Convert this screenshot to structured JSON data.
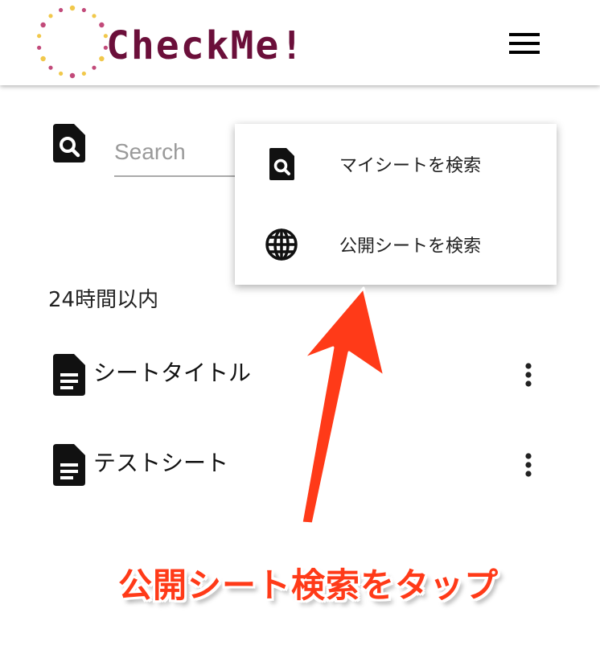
{
  "app": {
    "logo_text": "CheckMe!",
    "colors": {
      "logo_text": "#6b0f3a",
      "logo_dot_pink": "#c24a7a",
      "logo_dot_yellow": "#f1c84b"
    }
  },
  "header": {
    "menu_icon": "hamburger-menu-icon"
  },
  "search": {
    "placeholder": "Search",
    "value": "",
    "icon": "search-document-icon"
  },
  "dropdown": {
    "items": [
      {
        "label": "マイシートを検索",
        "icon": "search-document-icon"
      },
      {
        "label": "公開シートを検索",
        "icon": "globe-icon"
      }
    ]
  },
  "recent": {
    "title": "24時間以内",
    "items": [
      {
        "title": "シートタイトル",
        "icon": "document-icon",
        "menu_icon": "more-vertical-icon"
      },
      {
        "title": "テストシート",
        "icon": "document-icon",
        "menu_icon": "more-vertical-icon"
      }
    ]
  },
  "annotation": {
    "text": "公開シート検索をタップ",
    "color": "#ff3a18"
  }
}
